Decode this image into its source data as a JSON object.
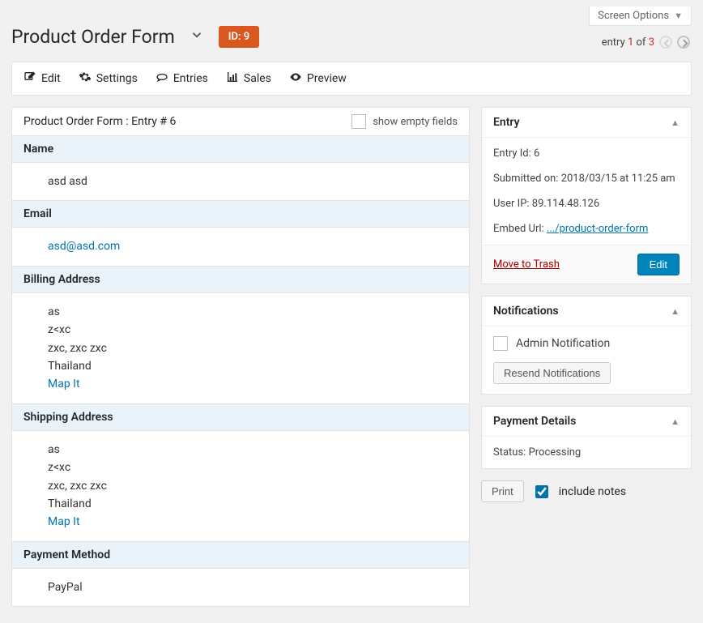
{
  "header": {
    "screen_options": "Screen Options",
    "pager": {
      "prefix": "entry",
      "current": "1",
      "of": "of",
      "total": "3"
    },
    "page_title": "Product Order Form",
    "id_badge": "ID: 9"
  },
  "toolbar": {
    "edit": "Edit",
    "settings": "Settings",
    "entries": "Entries",
    "sales": "Sales",
    "preview": "Preview"
  },
  "main": {
    "panel_title": "Product Order Form : Entry # 6",
    "show_empty": "show empty fields",
    "sections": {
      "name": {
        "label": "Name",
        "value": "asd asd"
      },
      "email": {
        "label": "Email",
        "value": "asd@asd.com"
      },
      "billing": {
        "label": "Billing Address",
        "line1": "as",
        "line2": "z<xc",
        "line3": "zxc, zxc zxc",
        "line4": "Thailand",
        "map": "Map It"
      },
      "shipping": {
        "label": "Shipping Address",
        "line1": "as",
        "line2": "z<xc",
        "line3": "zxc, zxc zxc",
        "line4": "Thailand",
        "map": "Map It"
      },
      "payment_method": {
        "label": "Payment Method",
        "value": "PayPal"
      }
    }
  },
  "side": {
    "entry_box": {
      "title": "Entry",
      "entry_id_label": "Entry Id:",
      "entry_id": "6",
      "submitted_label": "Submitted on:",
      "submitted": "2018/03/15 at 11:25 am",
      "ip_label": "User IP:",
      "ip": "89.114.48.126",
      "embed_label": "Embed Url:",
      "embed_url": ".../product-order-form",
      "trash": "Move to Trash",
      "edit": "Edit"
    },
    "notifications_box": {
      "title": "Notifications",
      "admin_notification": "Admin Notification",
      "resend": "Resend Notifications"
    },
    "payment_box": {
      "title": "Payment Details",
      "status_label": "Status:",
      "status": "Processing"
    },
    "print": {
      "button": "Print",
      "include_notes": "include notes"
    }
  }
}
